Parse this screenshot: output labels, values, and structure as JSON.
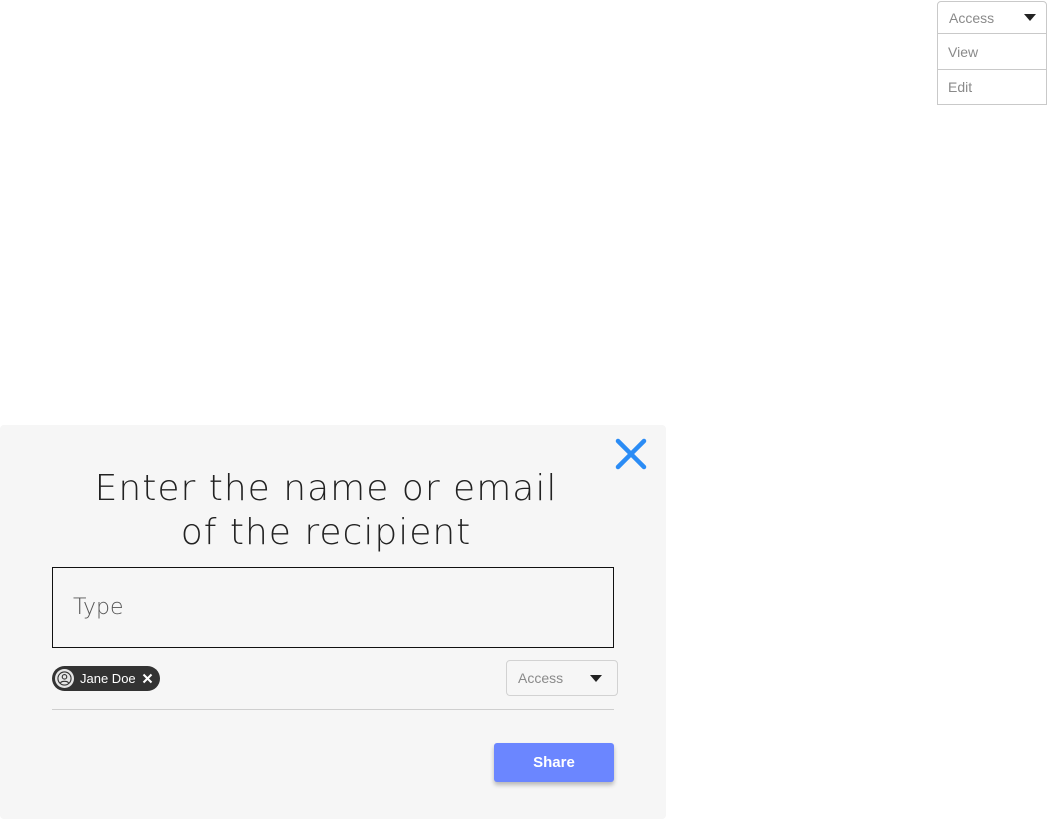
{
  "access_dropdown": {
    "label": "Access",
    "options": [
      "View",
      "Edit"
    ],
    "caret_icon": "caret-down-icon"
  },
  "panel": {
    "close_icon": "close-icon",
    "close_color": "#2b8cf5",
    "title_line1": "Enter the name or email",
    "title_line2": "of the recipient",
    "input_placeholder": "Type",
    "chip": {
      "name": "Jane Doe",
      "avatar_icon": "user-icon",
      "remove_icon": "close-icon"
    },
    "access_select": {
      "label": "Access",
      "caret_icon": "caret-down-icon"
    },
    "share_label": "Share",
    "share_color": "#6b86ff"
  }
}
